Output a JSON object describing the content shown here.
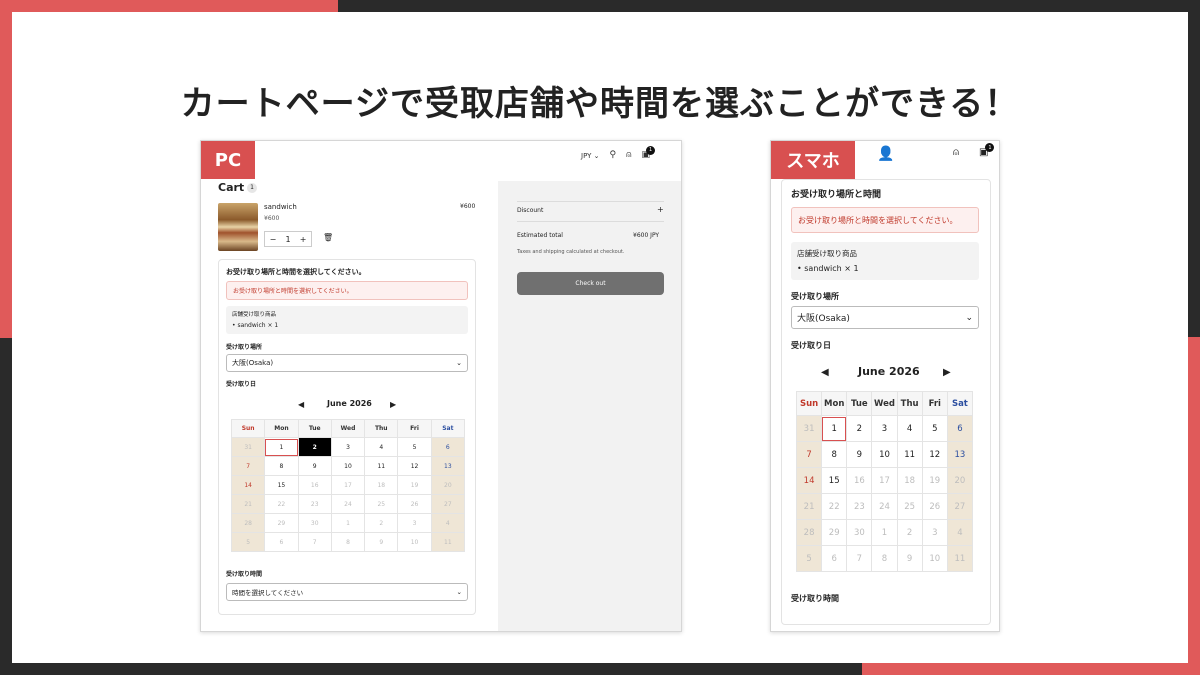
{
  "headline": "カートページで受取店舗や時間を選ぶことができる！",
  "pc": {
    "badge": "PC",
    "nav": {
      "currency": "JPY",
      "cart_count": "1"
    },
    "cart": {
      "title": "Cart",
      "count": "1",
      "item": {
        "name": "sandwich",
        "price": "¥600",
        "total": "¥600",
        "quantity": "1",
        "minus": "−",
        "plus": "+"
      }
    },
    "pickup": {
      "heading": "お受け取り場所と時間を選択してください。",
      "alert": "お受け取り場所と時間を選択してください。",
      "products_label": "店舗受け取り商品",
      "product_item": "sandwich × 1",
      "location_label": "受け取り場所",
      "location_value": "大阪(Osaka)",
      "date_label": "受け取り日",
      "time_label": "受け取り時間",
      "time_placeholder": "時間を選択してください"
    },
    "summary": {
      "discount_label": "Discount",
      "discount_toggle": "+",
      "estimated_label": "Estimated total",
      "estimated_value": "¥600 JPY",
      "tax_note": "Taxes and shipping calculated at checkout.",
      "checkout_label": "Check out"
    }
  },
  "sp": {
    "badge": "スマホ",
    "cart_count": "1",
    "pickup": {
      "heading": "お受け取り場所と時間",
      "alert": "お受け取り場所と時間を選択してください。",
      "products_label": "店舗受け取り商品",
      "product_item": "sandwich × 1",
      "location_label": "受け取り場所",
      "location_value": "大阪(Osaka)",
      "date_label": "受け取り日",
      "time_label": "受け取り時間"
    }
  },
  "calendar": {
    "month_label": "June 2026",
    "prev": "◀",
    "next": "▶",
    "weekdays": [
      "Sun",
      "Mon",
      "Tue",
      "Wed",
      "Thu",
      "Fri",
      "Sat"
    ],
    "weeks": [
      [
        "31",
        "1",
        "2",
        "3",
        "4",
        "5",
        "6"
      ],
      [
        "7",
        "8",
        "9",
        "10",
        "11",
        "12",
        "13"
      ],
      [
        "14",
        "15",
        "16",
        "17",
        "18",
        "19",
        "20"
      ],
      [
        "21",
        "22",
        "23",
        "24",
        "25",
        "26",
        "27"
      ],
      [
        "28",
        "29",
        "30",
        "1",
        "2",
        "3",
        "4"
      ],
      [
        "5",
        "6",
        "7",
        "8",
        "9",
        "10",
        "11"
      ]
    ],
    "available": [
      "1",
      "2",
      "3",
      "4",
      "5",
      "6",
      "7",
      "8",
      "9",
      "10",
      "11",
      "12",
      "13",
      "14",
      "15"
    ],
    "current_month_range": [
      1,
      30
    ],
    "today": "1",
    "pc_selected": "2"
  },
  "colors": {
    "accent": "#d85050",
    "frame_bg": "#2a2a2a",
    "weekend_bg": "#efe6d6",
    "sunday": "#c0392b",
    "saturday": "#2c4fa0"
  },
  "icons": {
    "search": "search-icon",
    "account": "account-icon",
    "cart": "cart-icon",
    "trash": "trash-icon",
    "chevron": "chevron-down-icon",
    "avatar": "user-avatar-icon"
  }
}
